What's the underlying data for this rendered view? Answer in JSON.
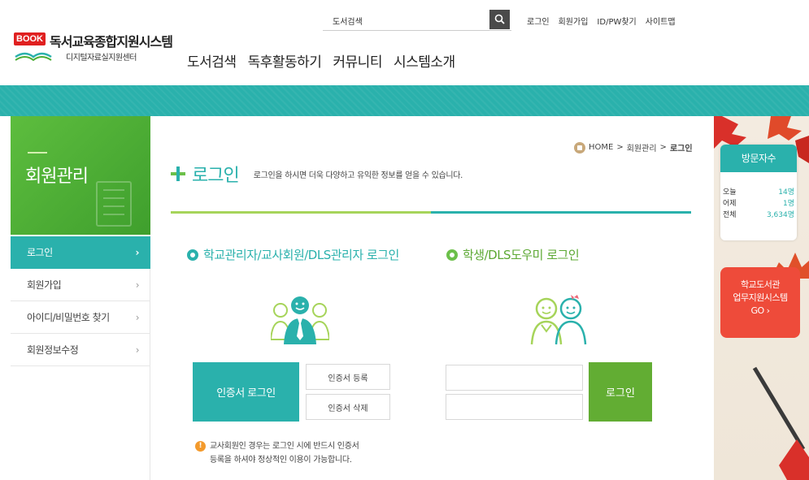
{
  "header": {
    "logo_badge": "BOOK",
    "logo_title": "독서교육종합지원시스템",
    "logo_subtitle": "디지털자료실지원센터",
    "search_value": "도서검색",
    "util_links": [
      "로그인",
      "회원가입",
      "ID/PW찾기",
      "사이트맵"
    ],
    "gnb": [
      "도서검색",
      "독후활동하기",
      "커뮤니티",
      "시스템소개"
    ]
  },
  "sidebar": {
    "title": "회원관리",
    "items": [
      {
        "label": "로그인",
        "chevron": "›"
      },
      {
        "label": "회원가입",
        "chevron": "›"
      },
      {
        "label": "아이디/비밀번호 찾기",
        "chevron": "›"
      },
      {
        "label": "회원정보수정",
        "chevron": "›"
      }
    ]
  },
  "breadcrumb": {
    "home": "HOME",
    "sep": ">",
    "level1": "회원관리",
    "level2": "로그인"
  },
  "main": {
    "title": "로그인",
    "description": "로그인을 하시면 더욱 다양하고 유익한 정보를 얻을 수 있습니다.",
    "teacher": {
      "section_title": "학교관리자/교사회원/DLS관리자 로그인",
      "cert_login": "인증서 로그인",
      "cert_register": "인증서 등록",
      "cert_delete": "인증서 삭제",
      "notice_icon": "!",
      "notice_line1": "교사회원인 경우는 로그인 시에 반드시 인증서",
      "notice_line2": "등록을 하셔야 정상적인 이용이 가능합니다."
    },
    "student": {
      "section_title": "학생/DLS도우미 로그인",
      "login_button": "로그인"
    }
  },
  "visitors": {
    "title": "방문자수",
    "rows": [
      {
        "label": "오늘",
        "value": "14명"
      },
      {
        "label": "어제",
        "value": "1명"
      },
      {
        "label": "전체",
        "value": "3,634명"
      }
    ]
  },
  "banner": {
    "line1": "학교도서관",
    "line2": "업무지원시스템",
    "line3": "GO ›"
  },
  "colors": {
    "teal": "#2ab1ac",
    "green": "#4cae36",
    "light_green": "#a6d45a",
    "red": "#ee4b3a",
    "orange": "#f39a2c"
  }
}
